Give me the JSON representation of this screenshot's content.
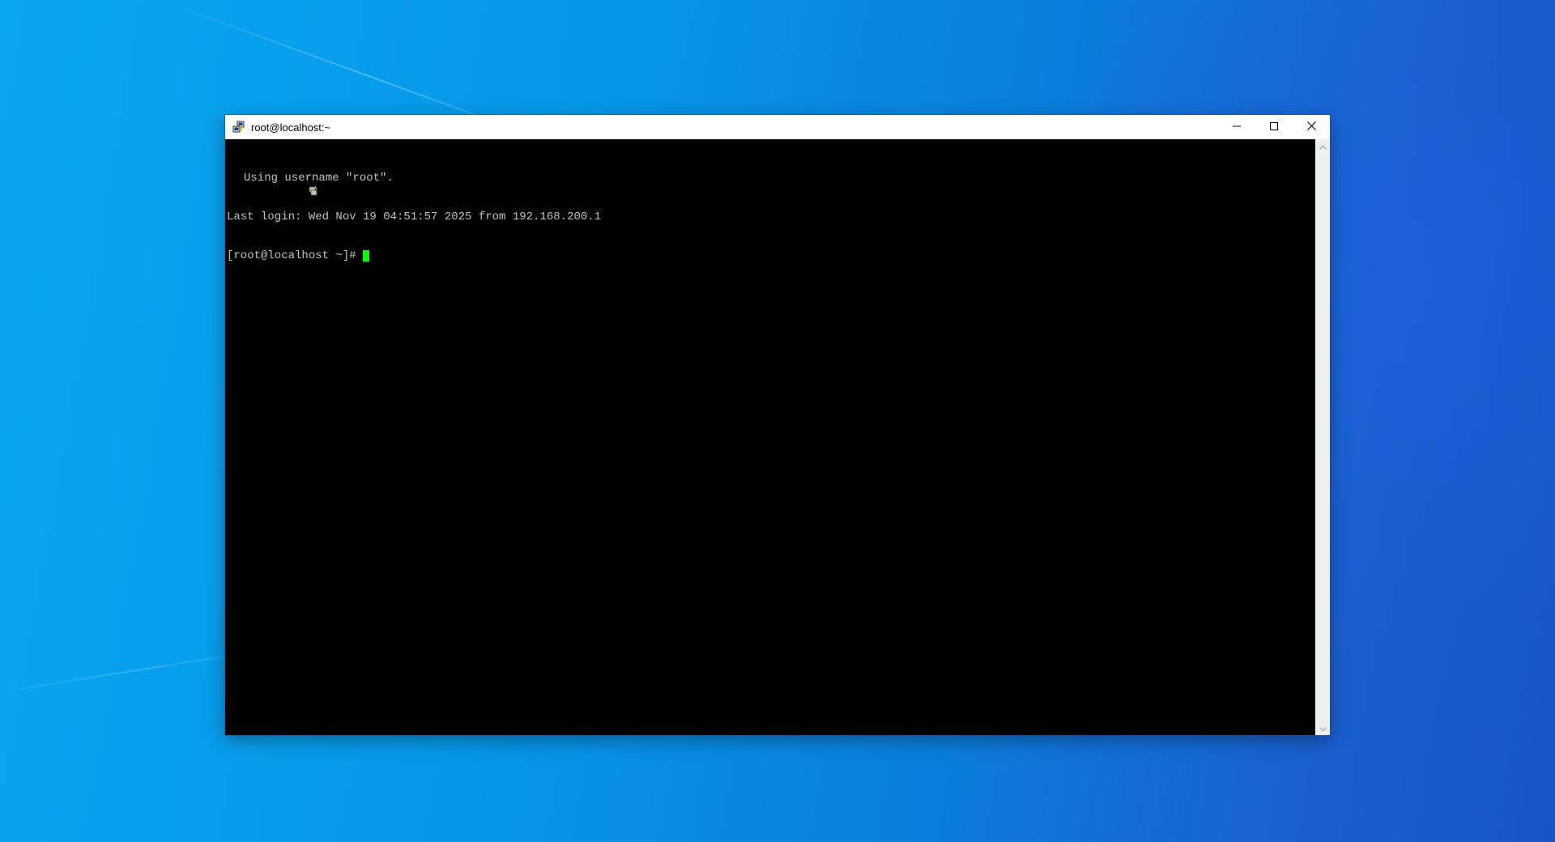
{
  "window": {
    "title": "root@localhost:~"
  },
  "icons": {
    "app": "putty-icon",
    "minimize": "minimize-icon",
    "maximize": "maximize-icon",
    "close": "close-icon",
    "scroll_up": "chevron-up-icon",
    "scroll_down": "chevron-down-icon"
  },
  "terminal": {
    "line1": "Using username \"root\".",
    "line2": "Last login: Wed Nov 19 04:51:57 2025 from 192.168.200.1",
    "prompt": "[root@localhost ~]#",
    "text_color": "#c0c0c0",
    "cursor_color": "#00ff00",
    "background": "#000000"
  }
}
